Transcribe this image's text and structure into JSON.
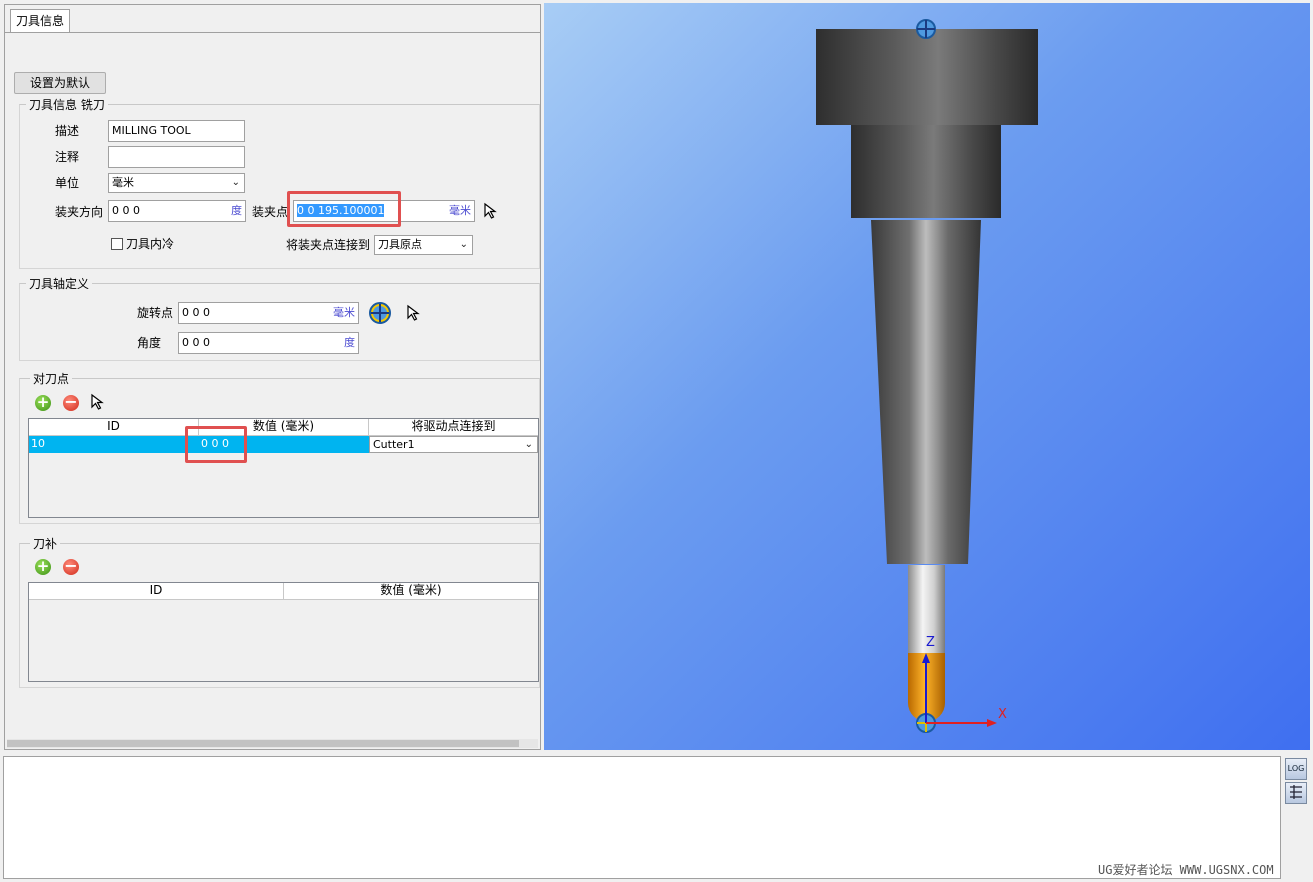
{
  "tabs": [
    {
      "label": "刀具信息"
    }
  ],
  "set_default_button": "设置为默认",
  "tool_info": {
    "title": "刀具信息 铣刀",
    "description_label": "描述",
    "description_value": "MILLING TOOL",
    "comment_label": "注释",
    "comment_value": "",
    "unit_label": "单位",
    "unit_value": "毫米",
    "clamp_dir_label": "装夹方向",
    "clamp_dir_value": "0 0 0",
    "clamp_dir_unit": "度",
    "clamp_point_label": "装夹点",
    "clamp_point_value": "0 0 195.100001",
    "clamp_point_unit": "毫米",
    "inner_cooling_label": "刀具内冷",
    "inner_cooling_checked": false,
    "connect_clamp_label": "将装夹点连接到",
    "connect_clamp_value": "刀具原点"
  },
  "axis_def": {
    "title": "刀具轴定义",
    "pivot_label": "旋转点",
    "pivot_value": "0 0 0",
    "pivot_unit": "毫米",
    "angle_label": "角度",
    "angle_value": "0 0 0",
    "angle_unit": "度"
  },
  "setting_points": {
    "title": "对刀点",
    "columns": [
      "ID",
      "数值 (毫米)",
      "将驱动点连接到"
    ],
    "rows": [
      {
        "id": "10",
        "value": "0 0 0",
        "link": "Cutter1"
      }
    ]
  },
  "compensation": {
    "title": "刀补",
    "columns": [
      "ID",
      "数值 (毫米)"
    ],
    "rows": []
  },
  "viewport": {
    "axis_z": "Z",
    "axis_x": "X",
    "colors": {
      "axis_z": "#1a1ad0",
      "axis_x": "#e02020",
      "tip": "#f0a000"
    }
  },
  "toolbar": {
    "log_icon": "LOG",
    "table_icon": "table-icon"
  },
  "watermark": "UG爱好者论坛 WWW.UGSNX.COM"
}
